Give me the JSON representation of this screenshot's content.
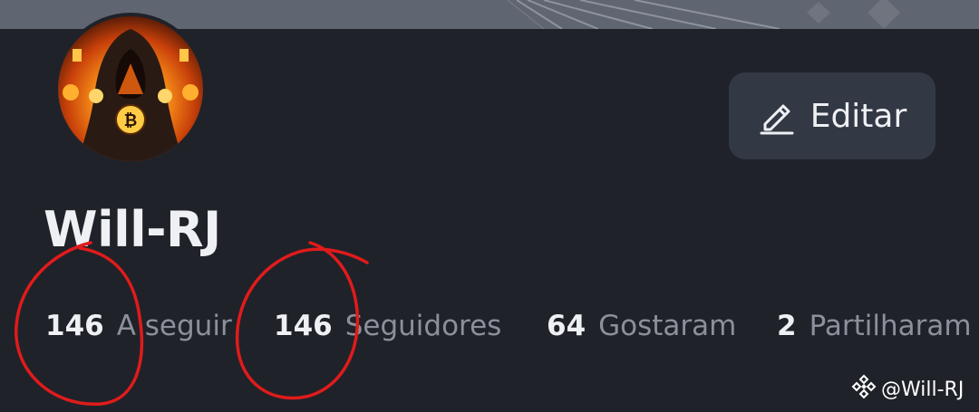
{
  "profile": {
    "username": "Will-RJ",
    "avatar_icon": "hooded-figure-bitcoin-avatar"
  },
  "actions": {
    "edit_label": "Editar",
    "edit_icon": "pencil-icon"
  },
  "stats": [
    {
      "value": "146",
      "label": "A seguir"
    },
    {
      "value": "146",
      "label": "Seguidores"
    },
    {
      "value": "64",
      "label": "Gostaram"
    },
    {
      "value": "2",
      "label": "Partilharam"
    }
  ],
  "watermark": {
    "text": "@Will-RJ",
    "icon": "binance-logo-icon"
  },
  "colors": {
    "background": "#1f2229",
    "banner": "#5f6571",
    "button": "#323844",
    "text_primary": "#eef0f4",
    "text_secondary": "#8b909b",
    "annotation_red": "#e01b1b"
  }
}
